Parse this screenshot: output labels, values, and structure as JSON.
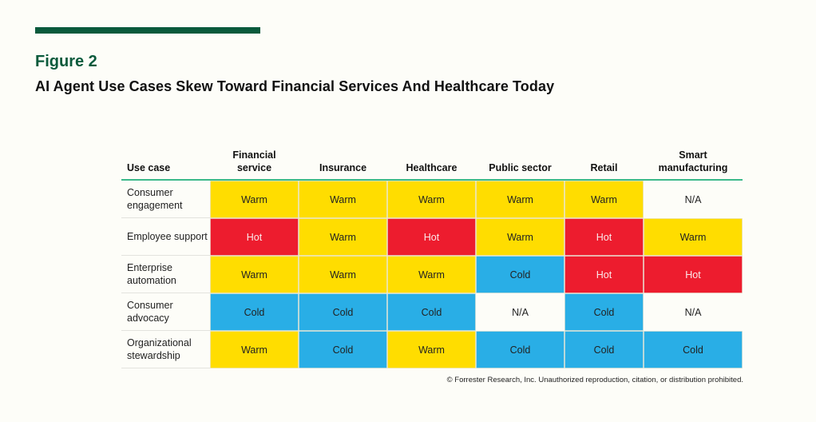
{
  "figure": {
    "label": "Figure 2",
    "title": "AI Agent Use Cases Skew Toward Financial Services And Healthcare Today"
  },
  "colors": {
    "brand_green": "#0a5a3c",
    "header_rule": "#3cb98a",
    "Warm": "#ffdd00",
    "Hot": "#ed1c2e",
    "Cold": "#29aee6",
    "N/A": "#fdfdf8"
  },
  "chart_data": {
    "type": "heatmap",
    "title": "AI Agent Use Cases Skew Toward Financial Services And Healthcare Today",
    "row_header": "Use case",
    "columns": [
      "Financial service",
      "Insurance",
      "Healthcare",
      "Public sector",
      "Retail",
      "Smart manufacturing"
    ],
    "rows": [
      "Consumer engagement",
      "Employee support",
      "Enterprise automation",
      "Consumer advocacy",
      "Organizational stewardship"
    ],
    "values": [
      [
        "Warm",
        "Warm",
        "Warm",
        "Warm",
        "Warm",
        "N/A"
      ],
      [
        "Hot",
        "Warm",
        "Hot",
        "Warm",
        "Hot",
        "Warm"
      ],
      [
        "Warm",
        "Warm",
        "Warm",
        "Cold",
        "Hot",
        "Hot"
      ],
      [
        "Cold",
        "Cold",
        "Cold",
        "N/A",
        "Cold",
        "N/A"
      ],
      [
        "Warm",
        "Cold",
        "Warm",
        "Cold",
        "Cold",
        "Cold"
      ]
    ],
    "legend": [
      "Hot",
      "Warm",
      "Cold",
      "N/A"
    ]
  },
  "footer": {
    "copyright": "© Forrester Research, Inc. Unauthorized reproduction, citation, or distribution prohibited."
  }
}
